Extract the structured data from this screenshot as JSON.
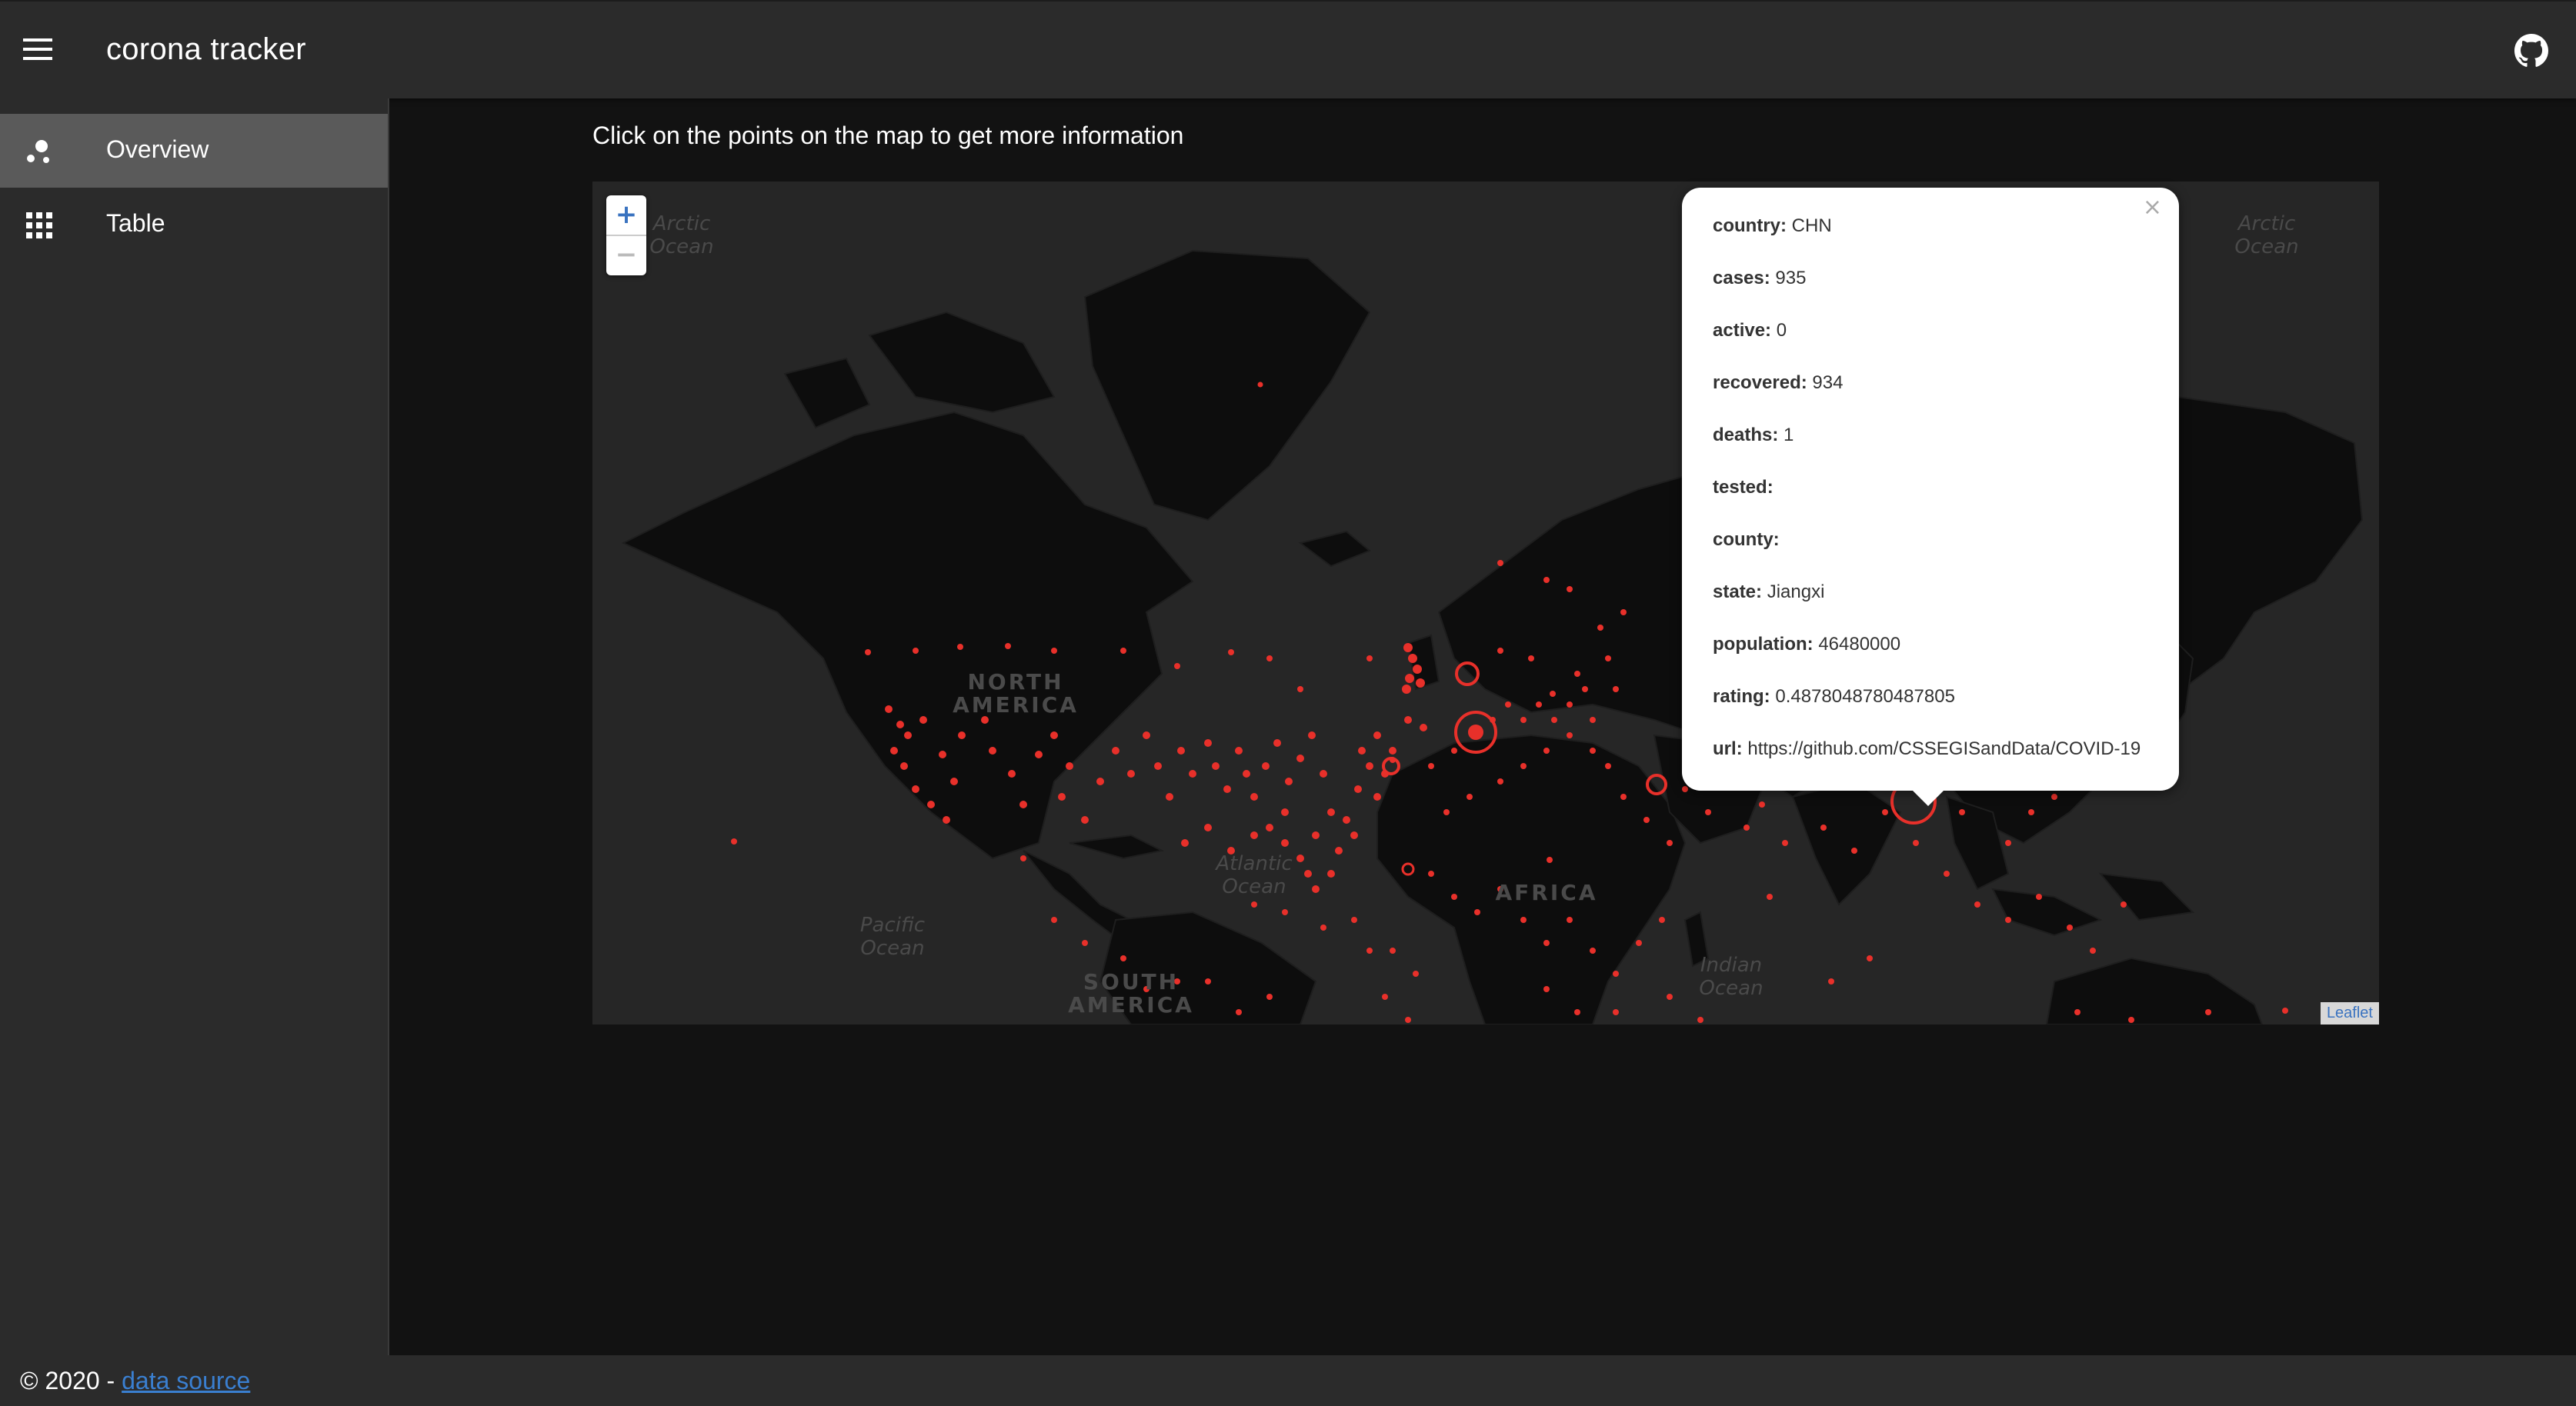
{
  "app": {
    "title": "corona tracker"
  },
  "icons": {
    "menu": "menu-icon",
    "github": "github-icon",
    "overview": "scatter-dots-icon",
    "table": "grid-icon"
  },
  "sidebar": {
    "items": [
      {
        "label": "Overview",
        "active": true
      },
      {
        "label": "Table",
        "active": false
      }
    ]
  },
  "main": {
    "instruction": "Click on the points on the map to get more information"
  },
  "map": {
    "zoom_in": "+",
    "zoom_out": "−",
    "attribution": "Leaflet",
    "labels": {
      "arctic_left": "Arctic\nOcean",
      "arctic_right": "Arctic\nOcean",
      "north_america": "NORTH\nAMERICA",
      "south_america": "SOUTH\nAMERICA",
      "africa": "AFRICA",
      "atlantic": "Atlantic\nOcean",
      "pacific": "Pacific\nOcean",
      "indian": "Indian\nOcean"
    },
    "colors": {
      "background": "#262626",
      "land": "#0d0d0d",
      "marker": "#e8302a"
    }
  },
  "popup": {
    "close": "×",
    "rows": [
      {
        "key": "country:",
        "value": "CHN"
      },
      {
        "key": "cases:",
        "value": "935"
      },
      {
        "key": "active:",
        "value": "0"
      },
      {
        "key": "recovered:",
        "value": "934"
      },
      {
        "key": "deaths:",
        "value": "1"
      },
      {
        "key": "tested:",
        "value": ""
      },
      {
        "key": "county:",
        "value": ""
      },
      {
        "key": "state:",
        "value": "Jiangxi"
      },
      {
        "key": "population:",
        "value": "46480000"
      },
      {
        "key": "rating:",
        "value": "0.4878048780487805"
      },
      {
        "key": "url:",
        "value": "https://github.com/CSSEGISandData/COVID-19"
      }
    ]
  },
  "footer": {
    "copyright": "© 2020  - ",
    "link": "data source"
  }
}
